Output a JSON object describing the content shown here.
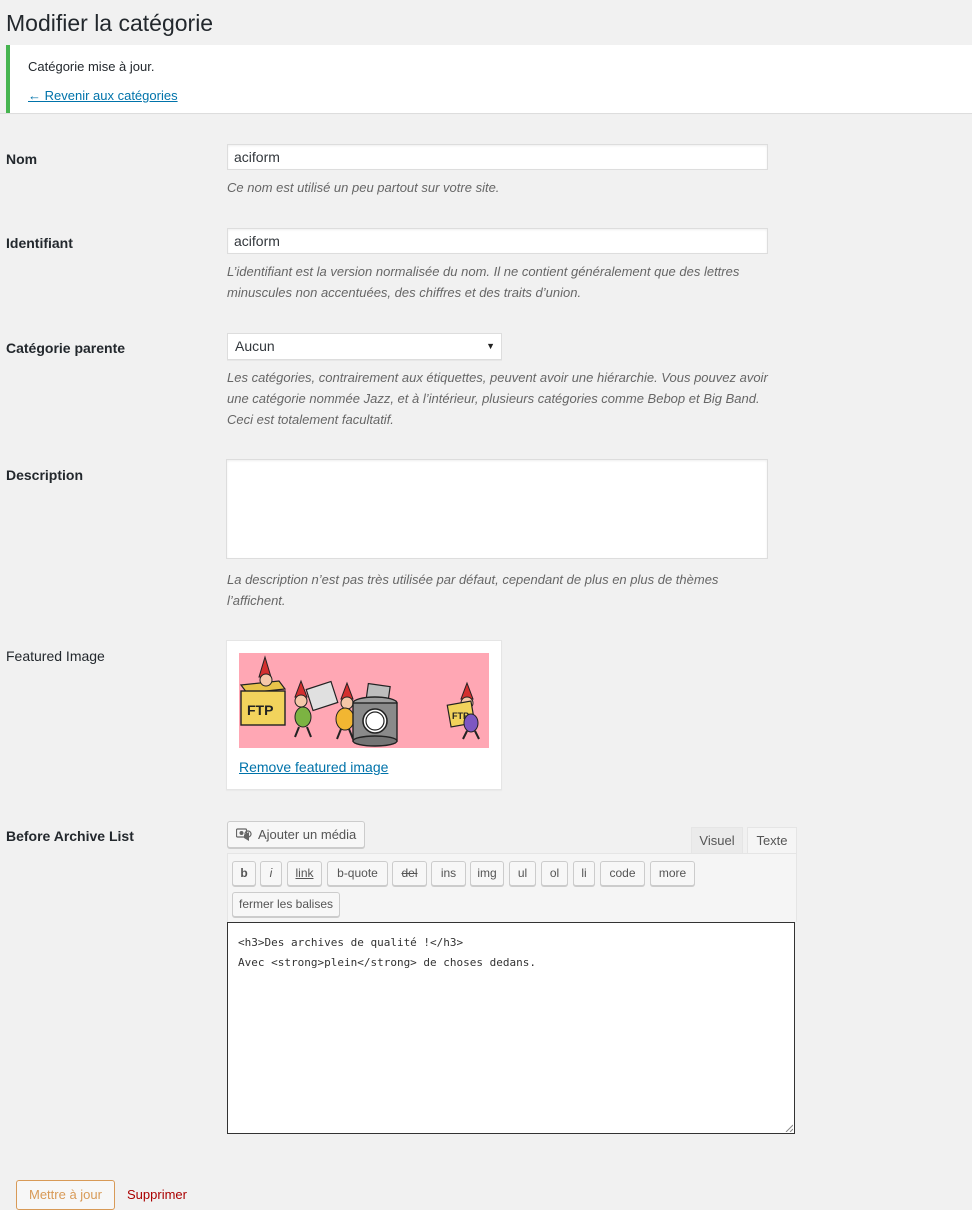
{
  "page": {
    "title": "Modifier la catégorie"
  },
  "notice": {
    "message": "Catégorie mise à jour.",
    "back_link": "← Revenir aux catégories",
    "accent_color": "#46b450"
  },
  "fields": {
    "name": {
      "label": "Nom",
      "value": "aciform",
      "help": "Ce nom est utilisé un peu partout sur votre site."
    },
    "slug": {
      "label": "Identifiant",
      "value": "aciform",
      "help_line1": "L’identifiant est la version normalisée du nom. Il ne contient généralement que des lettres",
      "help_line2": "minuscules non accentuées, des chiffres et des traits d’union."
    },
    "parent": {
      "label": "Catégorie parente",
      "selected": "Aucun",
      "help_line1": "Les catégories, contrairement aux étiquettes, peuvent avoir une hiérarchie. Vous pouvez avoir",
      "help_line2": "une catégorie nommée Jazz, et à l’intérieur, plusieurs catégories comme Bebop et Big Band.",
      "help_line3": "Ceci est totalement facultatif."
    },
    "description": {
      "label": "Description",
      "value": "",
      "help_line1": "La description n’est pas très utilisée par défaut, cependant de plus en plus de thèmes",
      "help_line2": "l’affichent."
    },
    "featured_image": {
      "label": "Featured Image",
      "remove_link": "Remove featured image",
      "image_texts": [
        "FTP",
        "FTP"
      ]
    },
    "before_archive": {
      "label": "Before Archive List",
      "add_media": "Ajouter un média",
      "tab_visual": "Visuel",
      "tab_text": "Texte",
      "quicktags": [
        "b",
        "i",
        "link",
        "b-quote",
        "del",
        "ins",
        "img",
        "ul",
        "ol",
        "li",
        "code",
        "more"
      ],
      "close_tags": "fermer les balises",
      "content_line1": "<h3>Des archives de qualité !</h3>",
      "content_line2": "Avec <strong>plein</strong> de choses dedans."
    }
  },
  "actions": {
    "update": "Mettre à jour",
    "delete": "Supprimer",
    "update_color": "#d89a57",
    "delete_color": "#aa0000"
  }
}
